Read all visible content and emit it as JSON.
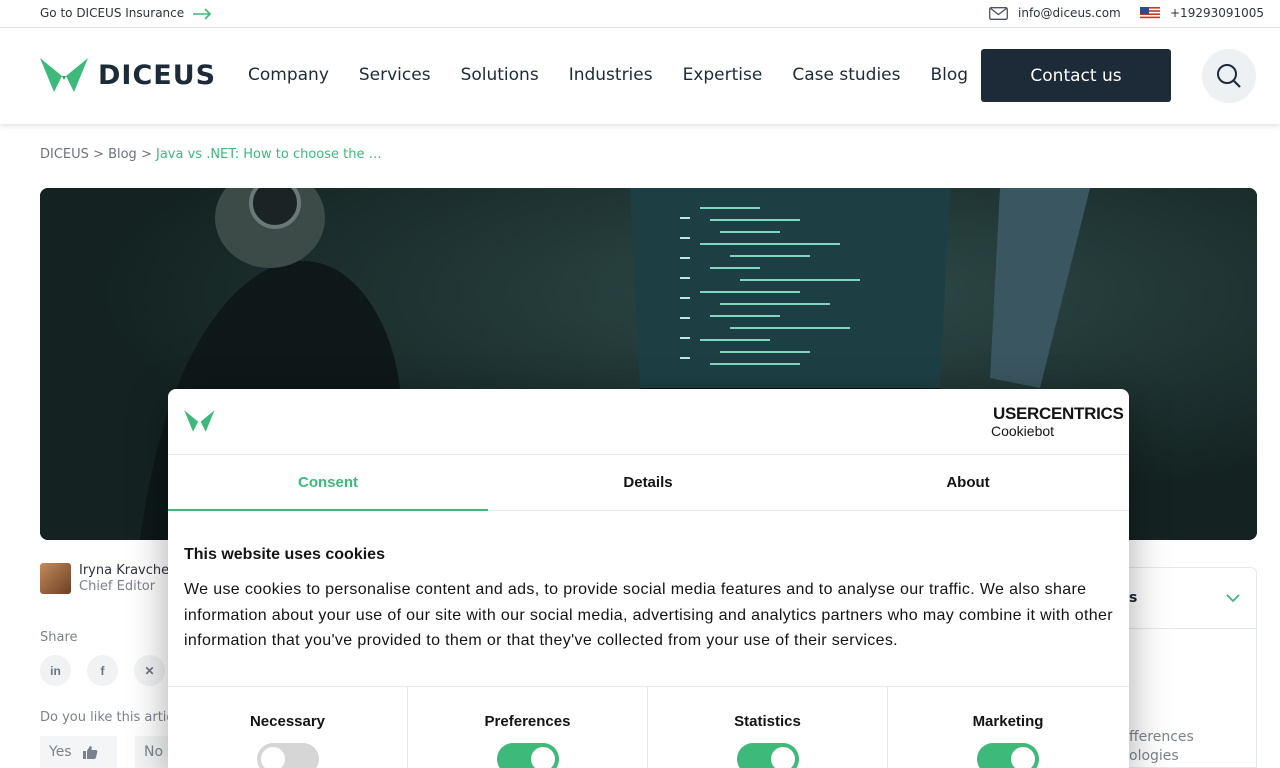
{
  "topbar": {
    "insurance_link": "Go to DICEUS Insurance",
    "email": "info@diceus.com",
    "phone": "+19293091005"
  },
  "header": {
    "logo_text": "DICEUS",
    "nav": [
      "Company",
      "Services",
      "Solutions",
      "Industries",
      "Expertise",
      "Case studies",
      "Blog"
    ],
    "contact_label": "Contact us"
  },
  "breadcrumb": {
    "home": "DICEUS",
    "sep1": " > ",
    "blog": "Blog",
    "sep2": " > ",
    "current": "Java vs .NET: How to choose the …"
  },
  "article": {
    "author_name": "Iryna Kravchenk",
    "author_role": "Chief Editor",
    "share_label": "Share",
    "share_icons": [
      "linkedin-icon",
      "facebook-icon",
      "x-icon"
    ],
    "like_question": "Do you like this artic",
    "yes_label": "Yes",
    "no_label": "No"
  },
  "toc": {
    "header_fragment": "s",
    "line1": "fferences",
    "line2": "ologies"
  },
  "cookie_modal": {
    "brand_name": "USERCENTRICS",
    "brand_sub": "Cookiebot",
    "tabs": [
      {
        "label": "Consent",
        "active": true
      },
      {
        "label": "Details",
        "active": false
      },
      {
        "label": "About",
        "active": false
      }
    ],
    "title": "This website uses cookies",
    "body": "We use cookies to personalise content and ads, to provide social media features and to analyse our traffic. We also share information about your use of our site with our social media, advertising and analytics partners who may combine it with other information that you've provided to them or that they've collected from your use of their services.",
    "categories": [
      {
        "label": "Necessary",
        "enabled": true,
        "locked": true
      },
      {
        "label": "Preferences",
        "enabled": true
      },
      {
        "label": "Statistics",
        "enabled": true
      },
      {
        "label": "Marketing",
        "enabled": true
      }
    ]
  },
  "colors": {
    "brand_green": "#3dba7a",
    "dark_navy": "#1d2a38"
  }
}
